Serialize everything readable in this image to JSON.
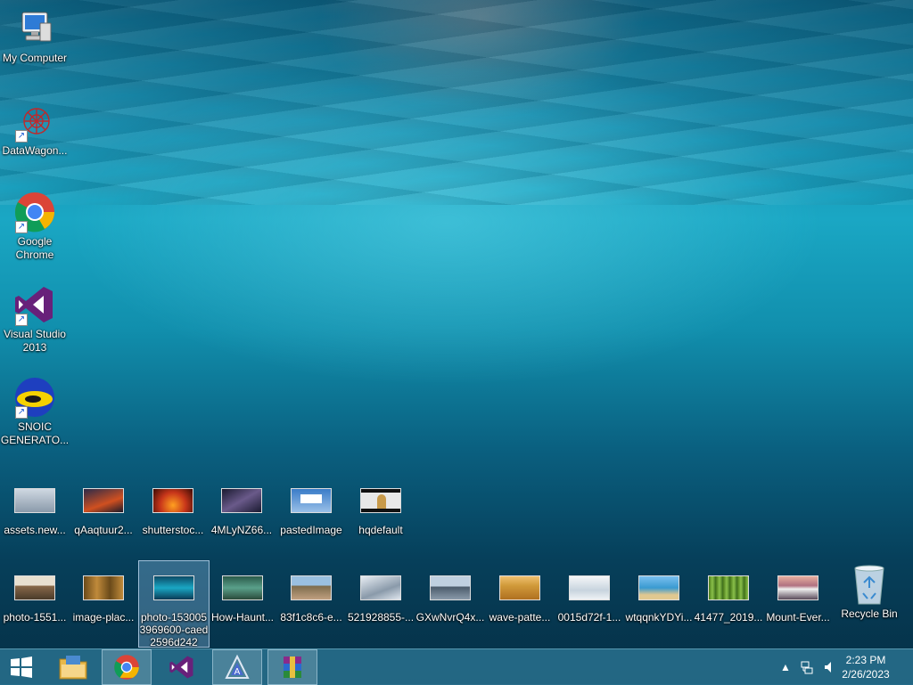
{
  "desktop": {
    "left_icons": [
      {
        "label": "My Computer",
        "icon": "computer-icon"
      },
      {
        "label": "DataWagon...",
        "icon": "datawagon-icon"
      },
      {
        "label": "Google\nChrome",
        "icon": "chrome-icon"
      },
      {
        "label": "Visual Studio\n2013",
        "icon": "visual-studio-icon"
      },
      {
        "label": "SNOIC\nGENERATO...",
        "icon": "snoic-icon"
      }
    ],
    "row1": [
      "assets.new...",
      "qAaqtuur2...",
      "shutterstoc...",
      "4MLyNZ66...",
      "pastedImage",
      "hqdefault"
    ],
    "row2": [
      "photo-1551...",
      "image-plac...",
      "photo-153005\n3969600-caed\n2596d242",
      "How-Haunt...",
      "83f1c8c6-e...",
      "521928855-...",
      "GXwNvrQ4x...",
      "wave-patte...",
      "0015d72f-1...",
      "wtqqnkYDYi...",
      "41477_2019...",
      "Mount-Ever...",
      "Recycle Bin"
    ],
    "thumb_colors": {
      "row1": [
        "#b9c8d6",
        "#4a3a5c",
        "#c8361a",
        "#2a2a48",
        "#3a7cc8",
        "#f0f0f0"
      ],
      "row2": [
        "#8a6a4a",
        "#9a6a2a",
        "#1a8fb0",
        "#3a7a6a",
        "#8aa0b8",
        "#c0ccd8",
        "#6a7a8a",
        "#d09a3a",
        "#e0e8ee",
        "#3a9ad0",
        "#5a8a2a",
        "#8a6a7a"
      ]
    }
  },
  "taskbar": {
    "clock_time": "2:23 PM",
    "clock_date": "2/26/2023",
    "pinned": [
      "start-button",
      "file-explorer",
      "chrome",
      "visual-studio",
      "app-a",
      "winrar"
    ]
  }
}
